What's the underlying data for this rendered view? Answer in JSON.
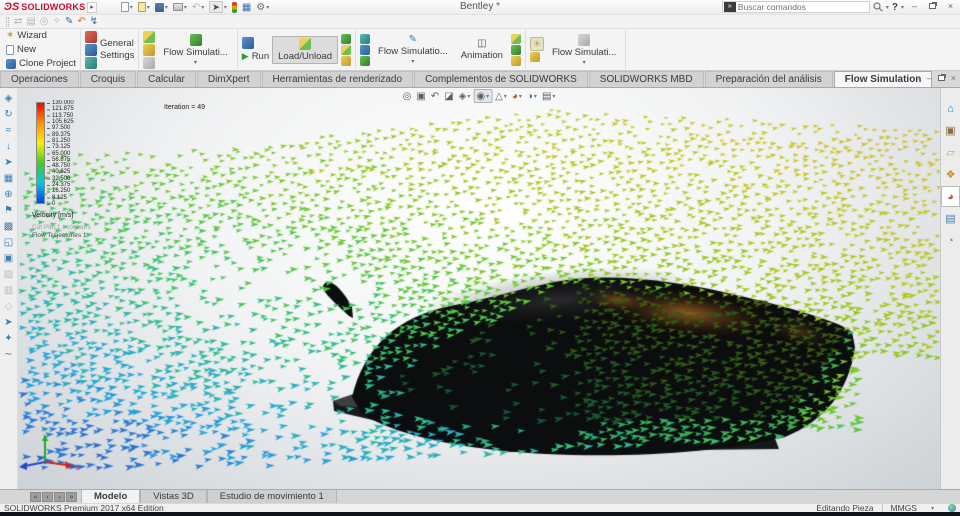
{
  "window": {
    "app_name": "SOLIDWORKS",
    "doc_title": "Bentley *",
    "search_placeholder": "Buscar comandos",
    "help_label": "?"
  },
  "quick_access_icons": [
    {
      "name": "new-document-icon"
    },
    {
      "name": "open-document-icon"
    },
    {
      "name": "save-icon"
    },
    {
      "name": "print-icon"
    },
    {
      "name": "undo-icon"
    },
    {
      "name": "select-cursor-icon"
    },
    {
      "name": "display-states-icon"
    },
    {
      "name": "options-grid-icon"
    },
    {
      "name": "settings-gear-icon"
    }
  ],
  "command_bar_icons": [
    {
      "name": "rebuild-icon",
      "glyph": "⇄",
      "disabled": true
    },
    {
      "name": "snapshot-icon",
      "glyph": "▤",
      "disabled": true
    },
    {
      "name": "magnify-icon",
      "glyph": "◎",
      "disabled": true
    },
    {
      "name": "search-options-icon",
      "glyph": "✧",
      "disabled": true
    },
    {
      "name": "sketch-pen-icon",
      "glyph": "✎",
      "color": "#3566a8"
    },
    {
      "name": "rotate-view-icon",
      "glyph": "↶",
      "color": "#c87b2a"
    },
    {
      "name": "reference-triad-icon",
      "glyph": "↯",
      "color": "#2e6da4"
    }
  ],
  "ribbon": {
    "wizard": "Wizard",
    "new": "New",
    "clone_project": "Clone Project",
    "general_settings_1": "General",
    "general_settings_2": "Settings",
    "flow_sim_dropdown_1": "Flow Simulati...",
    "run": "Run",
    "load_unload": "Load/Unload",
    "flow_sim_dropdown_2": "Flow Simulatio...",
    "animation": "Animation",
    "flow_sim_dropdown_3": "Flow Simulati..."
  },
  "command_tabs": [
    {
      "label": "Operaciones"
    },
    {
      "label": "Croquis"
    },
    {
      "label": "Calcular"
    },
    {
      "label": "DimXpert"
    },
    {
      "label": "Herramientas de renderizado"
    },
    {
      "label": "Complementos de SOLIDWORKS"
    },
    {
      "label": "SOLIDWORKS MBD"
    },
    {
      "label": "Preparación del análisis"
    },
    {
      "label": "Flow Simulation",
      "active": true
    }
  ],
  "headsup_icons": [
    {
      "name": "zoom-to-fit-icon",
      "glyph": "◎"
    },
    {
      "name": "zoom-to-area-icon",
      "glyph": "▣"
    },
    {
      "name": "previous-view-icon",
      "glyph": "↶"
    },
    {
      "name": "section-view-icon",
      "glyph": "◪"
    },
    {
      "name": "view-orientation-icon",
      "glyph": "◈",
      "caret": true
    },
    {
      "name": "display-style-icon",
      "glyph": "◉",
      "caret": true,
      "active": true
    },
    {
      "name": "hide-show-items-icon",
      "glyph": "△",
      "caret": true
    },
    {
      "name": "edit-appearance-icon",
      "glyph": "◕",
      "caret": true,
      "color": "#c45537"
    },
    {
      "name": "apply-scene-icon",
      "glyph": "◑",
      "caret": true,
      "color": "#3b7fb5"
    },
    {
      "name": "view-settings-icon",
      "glyph": "▤",
      "caret": true
    }
  ],
  "feature_toolbar_icons": [
    {
      "name": "computational-domain-icon",
      "glyph": "◈"
    },
    {
      "name": "fluid-subdomain-icon",
      "glyph": "↻"
    },
    {
      "name": "boundary-condition-icon",
      "glyph": "≈"
    },
    {
      "name": "fan-icon",
      "glyph": "↓"
    },
    {
      "name": "heat-source-icon",
      "glyph": "➤"
    },
    {
      "name": "porous-medium-icon",
      "glyph": "▦"
    },
    {
      "name": "initial-condition-icon",
      "glyph": "⊕"
    },
    {
      "name": "goal-icon",
      "glyph": "⚑"
    },
    {
      "name": "local-mesh-icon",
      "glyph": "▩"
    },
    {
      "name": "component-control-icon",
      "glyph": "◱"
    },
    {
      "name": "results-icon",
      "glyph": "▣"
    },
    {
      "name": "mesh-plot-icon",
      "glyph": "▨",
      "disabled": true
    },
    {
      "name": "cut-plot-icon",
      "glyph": "▥",
      "disabled": true
    },
    {
      "name": "surface-plot-icon",
      "glyph": "◇",
      "disabled": true
    },
    {
      "name": "isosurface-plot-icon",
      "glyph": "➤"
    },
    {
      "name": "flow-trajectories-icon",
      "glyph": "✦"
    },
    {
      "name": "xy-plot-icon",
      "glyph": "∼"
    }
  ],
  "task_pane_icons": [
    {
      "name": "home-icon",
      "glyph": "⌂",
      "color": "#3b7fb5"
    },
    {
      "name": "design-library-icon",
      "glyph": "▣",
      "color": "#8a6d3b"
    },
    {
      "name": "file-explorer-icon",
      "glyph": "▱",
      "color": "#c2a24a"
    },
    {
      "name": "view-palette-icon",
      "glyph": "❖",
      "color": "#d08a2e"
    },
    {
      "name": "appearances-icon",
      "glyph": "◕",
      "color": "#c45537",
      "active": true
    },
    {
      "name": "custom-properties-icon",
      "glyph": "▤",
      "color": "#3b7fb5"
    },
    {
      "name": "forum-icon",
      "glyph": "◔",
      "color": "#7a7fb5"
    }
  ],
  "viewport": {
    "iteration": "Iteration = 49",
    "legend": {
      "title": "Velocity [m/s]",
      "values": [
        "130.000",
        "121.875",
        "113.750",
        "105.625",
        "97.500",
        "89.375",
        "81.250",
        "73.125",
        "65.000",
        "56.875",
        "48.750",
        "40.625",
        "32.500",
        "24.375",
        "16.250",
        "8.125",
        "0"
      ]
    },
    "plots": [
      "Cut Plot 1 : contours",
      "Flow Trajectories 1"
    ],
    "triad": {
      "x": "X",
      "y": "Y",
      "z": "Z"
    }
  },
  "sheet_tabs": [
    {
      "label": "Modelo",
      "active": true
    },
    {
      "label": "Vistas 3D"
    },
    {
      "label": "Estudio de movimiento 1"
    }
  ],
  "status_bar": {
    "edition": "SOLIDWORKS Premium 2017 x64 Edition",
    "mode": "Editando Pieza",
    "units": "MMGS"
  },
  "colors": {
    "brand_red": "#c8102e",
    "legend_gradient": [
      "#ff0000",
      "#ff9000",
      "#ffee00",
      "#44cc22",
      "#00c8e8",
      "#0040ee"
    ],
    "flow_palette": [
      "#2b5fd0",
      "#27a7dd",
      "#2fc27a",
      "#63c92f",
      "#a8c81e",
      "#c9c620",
      "#d9b82e"
    ],
    "car_body": "#0c0d0e",
    "ground_plate": "#17181a",
    "reflection": "#b06928",
    "triad_x": "#cc2222",
    "triad_y": "#22aa22",
    "triad_z": "#2244cc"
  }
}
